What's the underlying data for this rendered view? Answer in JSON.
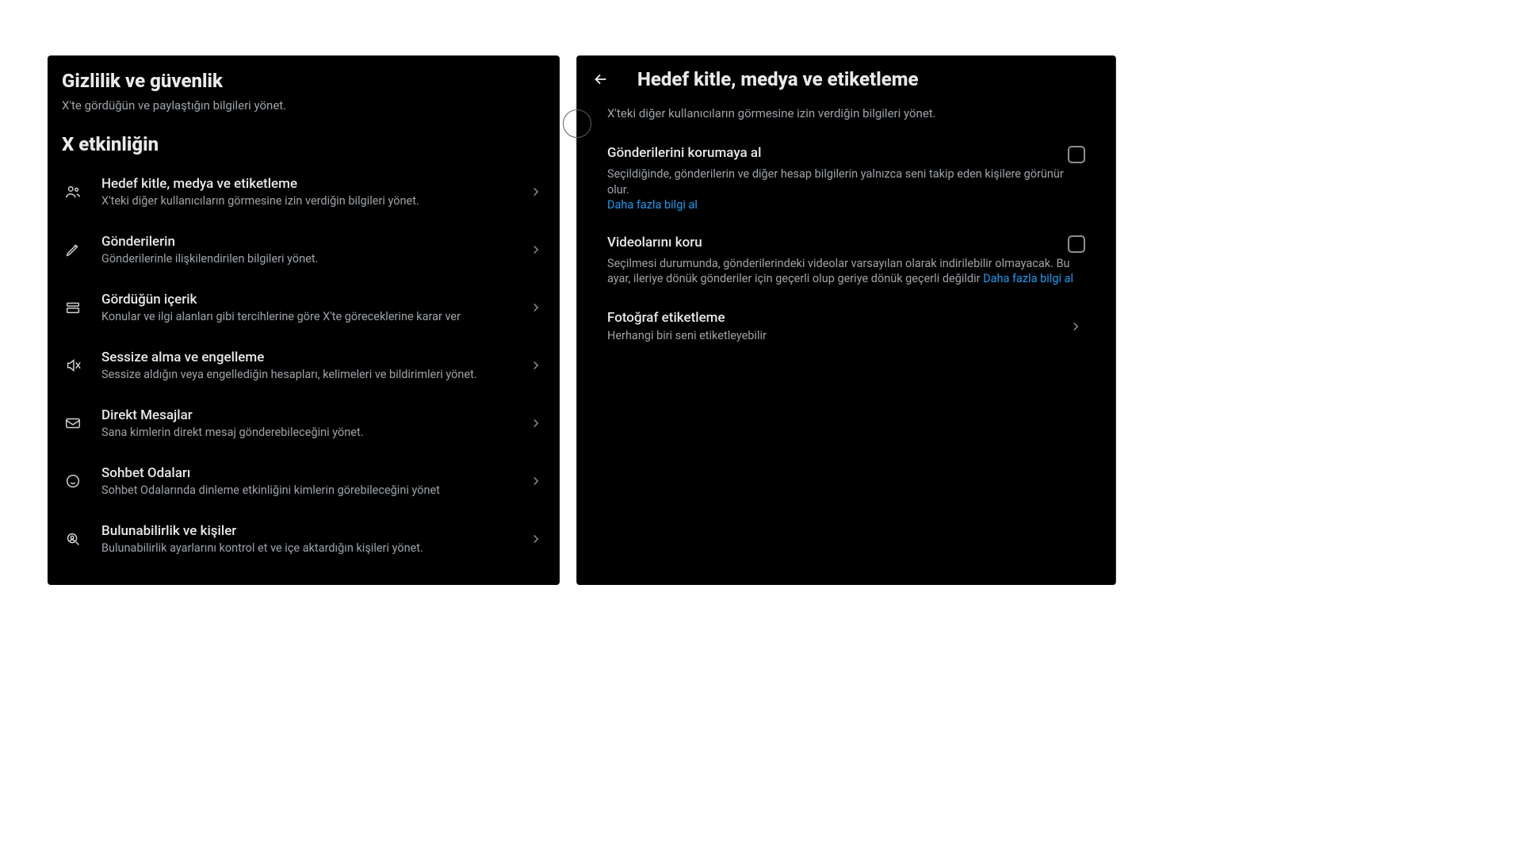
{
  "left": {
    "title": "Gizlilik ve güvenlik",
    "subtitle": "X'te gördüğün ve paylaştığın bilgileri yönet.",
    "section": "X etkinliğin",
    "items": [
      {
        "icon": "audience",
        "title": "Hedef kitle, medya ve etiketleme",
        "desc": "X'teki diğer kullanıcıların görmesine izin verdiğin bilgileri yönet."
      },
      {
        "icon": "pencil",
        "title": "Gönderilerin",
        "desc": "Gönderilerinle ilişkilendirilen bilgileri yönet."
      },
      {
        "icon": "content",
        "title": "Gördüğün içerik",
        "desc": "Konular ve ilgi alanları gibi tercihlerine göre X'te göreceklerine karar ver"
      },
      {
        "icon": "mute",
        "title": "Sessize alma ve engelleme",
        "desc": "Sessize aldığın veya engellediğin hesapları, kelimeleri ve bildirimleri yönet."
      },
      {
        "icon": "envelope",
        "title": "Direkt Mesajlar",
        "desc": "Sana kimlerin direkt mesaj gönderebileceğini yönet."
      },
      {
        "icon": "smile",
        "title": "Sohbet Odaları",
        "desc": "Sohbet Odalarında dinleme etkinliğini kimlerin görebileceğini yönet"
      },
      {
        "icon": "search-person",
        "title": "Bulunabilirlik ve kişiler",
        "desc": "Bulunabilirlik ayarlarını kontrol et ve içe aktardığın kişileri yönet."
      }
    ]
  },
  "right": {
    "title": "Hedef kitle, medya ve etiketleme",
    "subtitle": "X'teki diğer kullanıcıların görmesine izin verdiğin bilgileri yönet.",
    "protect_posts": {
      "title": "Gönderilerini korumaya al",
      "desc": "Seçildiğinde, gönderilerin ve diğer hesap bilgilerin yalnızca seni takip eden kişilere görünür olur.",
      "learn_more": "Daha fazla bilgi al"
    },
    "protect_videos": {
      "title": "Videolarını koru",
      "desc": "Seçilmesi durumunda, gönderilerindeki videolar varsayılan olarak indirilebilir olmayacak. Bu ayar, ileriye dönük gönderiler için geçerli olup geriye dönük geçerli değildir",
      "learn_more": "Daha fazla bilgi al"
    },
    "photo_tagging": {
      "title": "Fotoğraf etiketleme",
      "desc": "Herhangi biri seni etiketleyebilir"
    }
  }
}
